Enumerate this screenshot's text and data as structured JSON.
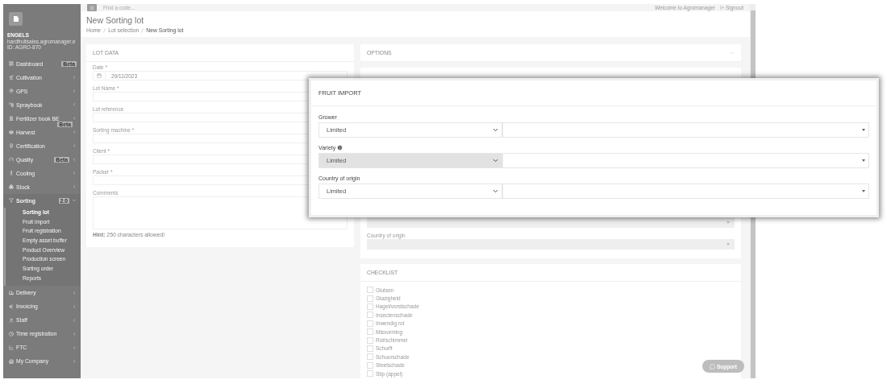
{
  "sidebar": {
    "user": {
      "name": "ENGELS",
      "email": "hardfruitsales.agromanager.e",
      "id": "ID: AGRO-870"
    },
    "items": [
      {
        "label": "Dashboard",
        "badge": "Beta",
        "expanded": false
      },
      {
        "label": "Cultivation",
        "expanded": false
      },
      {
        "label": "GPS",
        "expanded": false
      },
      {
        "label": "Spraybook",
        "expanded": false
      },
      {
        "label": "Fertilizer book BE",
        "badge": "Beta",
        "expanded": false
      },
      {
        "label": "Harvest",
        "expanded": false
      },
      {
        "label": "Certification",
        "expanded": false
      },
      {
        "label": "Quality",
        "badge": "Beta",
        "expanded": false
      },
      {
        "label": "Cooling",
        "expanded": false
      },
      {
        "label": "Stock",
        "expanded": false
      },
      {
        "label": "Sorting",
        "badge": "2.0",
        "expanded": true,
        "children": [
          {
            "label": "Sorting lot",
            "selected": true
          },
          {
            "label": "Fruit import",
            "selected": false
          },
          {
            "label": "Fruit registration",
            "selected": false
          },
          {
            "label": "Empty asset buffer",
            "selected": false
          },
          {
            "label": "Product Overview",
            "selected": false
          },
          {
            "label": "Production screen",
            "selected": false
          },
          {
            "label": "Sorting order",
            "selected": false
          },
          {
            "label": "Reports",
            "selected": false
          }
        ]
      },
      {
        "label": "Delivery",
        "expanded": false
      },
      {
        "label": "Invoicing",
        "expanded": false
      },
      {
        "label": "Staff",
        "expanded": false
      },
      {
        "label": "Time registration",
        "expanded": false
      },
      {
        "label": "FTC",
        "expanded": false
      },
      {
        "label": "My Company",
        "expanded": false
      }
    ]
  },
  "topbar": {
    "search_placeholder": "Find a code...",
    "welcome": "Welcome to Agromanager",
    "signout": "Signout"
  },
  "page": {
    "title": "New Sorting lot",
    "breadcrumbs": [
      "Home",
      "Lot selection",
      "New Sorting lot"
    ]
  },
  "lot_data": {
    "title": "LOT DATA",
    "fields": [
      {
        "label": "Date *",
        "kind": "date",
        "value": "29/11/2023"
      },
      {
        "label": "Lot Name *",
        "kind": "text"
      },
      {
        "label": "Lot reference",
        "kind": "text"
      },
      {
        "label": "Sorting machine *",
        "kind": "text"
      },
      {
        "label": "Client *",
        "kind": "text"
      },
      {
        "label": "Packer *",
        "kind": "text"
      },
      {
        "label": "Comments",
        "kind": "textarea"
      }
    ],
    "hint": "**Hint:** 250 characters allowed!"
  },
  "options": {
    "title": "OPTIONS"
  },
  "fruit_import_panel": {
    "fields": [
      {
        "kind": "select",
        "disabled": true
      },
      {
        "label": "Country of origin",
        "kind": "select",
        "disabled": true
      }
    ]
  },
  "checklist": {
    "title": "CHECKLIST",
    "items": [
      {
        "label": "Glutsen",
        "checked": false
      },
      {
        "label": "Glazigheid",
        "checked": false
      },
      {
        "label": "Hagel/vorstschade",
        "checked": false
      },
      {
        "label": "Insectenschade",
        "checked": false
      },
      {
        "label": "Inwendig rot",
        "checked": false
      },
      {
        "label": "Misvorming",
        "checked": false
      },
      {
        "label": "Rot/schimmel",
        "checked": false
      },
      {
        "label": "Schurft",
        "checked": false
      },
      {
        "label": "Schuurschade",
        "checked": false
      },
      {
        "label": "Steelschade",
        "checked": false
      },
      {
        "label": "Stip (appel)",
        "checked": false
      }
    ]
  },
  "support_button": "Support",
  "fruit_import_popup": {
    "title": "FRUIT IMPORT",
    "rows": [
      {
        "label": "Grower",
        "info": false,
        "filter": "Limited",
        "disabled": false
      },
      {
        "label": "Variety",
        "info": true,
        "filter": "Limited",
        "disabled": true
      },
      {
        "label": "Country of origin",
        "info": false,
        "filter": "Limited",
        "disabled": false
      }
    ]
  }
}
